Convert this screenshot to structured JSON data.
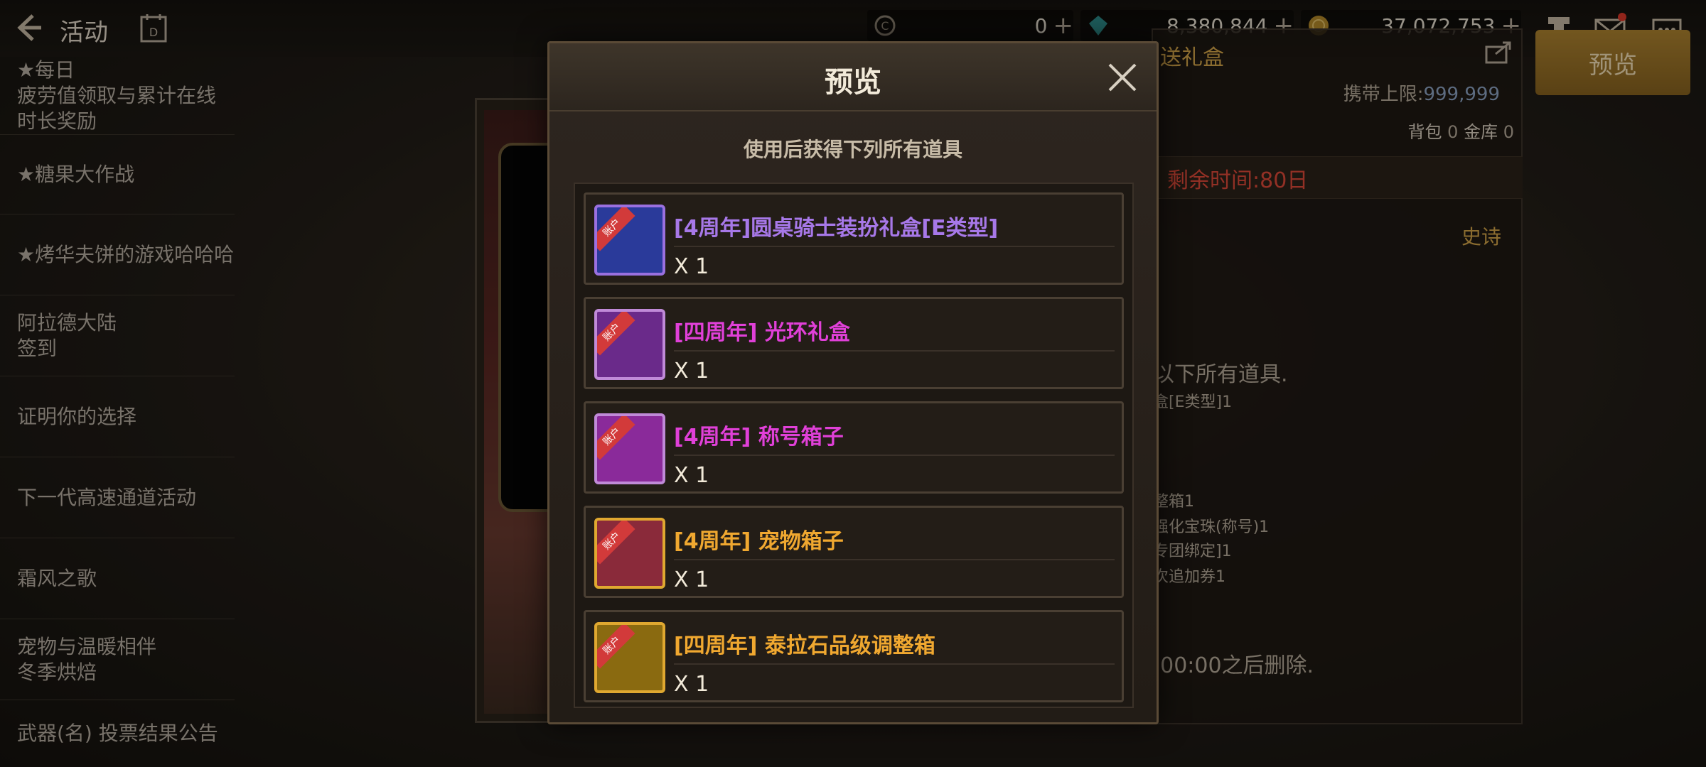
{
  "topbar": {
    "title": "活动",
    "calendar_label": "D",
    "currencies": [
      {
        "icon": "coin-c-icon",
        "amount": "0"
      },
      {
        "icon": "crystal-icon",
        "amount": "8,380,844"
      },
      {
        "icon": "gold-coin-icon",
        "amount": "37,072,753"
      }
    ]
  },
  "menu": {
    "items": [
      {
        "label": "★每日\n疲劳值领取与累计在线时长奖励"
      },
      {
        "label": "★糖果大作战"
      },
      {
        "label": "★烤华夫饼的游戏哈哈哈"
      },
      {
        "label": "阿拉德大陆\n签到"
      },
      {
        "label": "证明你的选择"
      },
      {
        "label": "下一代高速通道活动"
      },
      {
        "label": "霜风之歌"
      },
      {
        "label": "宠物与温暖相伴\n冬季烘焙"
      },
      {
        "label": "武器(名) 投票结果公告"
      }
    ]
  },
  "detail": {
    "title_fragment": "送礼盒",
    "limit_label": "携带上限:",
    "limit_value": "999,999",
    "bag_label": "背包",
    "bag_value": "0",
    "vault_label": "金库",
    "vault_value": "0",
    "time_left": "剩余时间:80日",
    "rarity": "史诗",
    "desc_lines": [
      "以下所有道具.",
      "盒[E类型]1",
      "",
      "整箱1",
      "强化宝珠(称号)1",
      "专团绑定]1",
      "次追加券1"
    ],
    "delete_note": ":00:00之后删除."
  },
  "preview_button": "预览",
  "modal": {
    "title": "预览",
    "subtitle": "使用后获得下列所有道具",
    "items": [
      {
        "name": "[4周年]圆桌骑士装扮礼盒[E类型]",
        "qty": "X 1",
        "color": "#a778e8",
        "border": "#9a70e0",
        "tag": "账户",
        "art": "#2a3a9a"
      },
      {
        "name": "[四周年] 光环礼盒",
        "qty": "X 1",
        "color": "#e040d8",
        "border": "#c08ad8",
        "tag": "账户",
        "art": "#6a2a8a"
      },
      {
        "name": "[4周年] 称号箱子",
        "qty": "X 1",
        "color": "#e040d8",
        "border": "#c08ad8",
        "tag": "账户",
        "art": "#8a2a9a"
      },
      {
        "name": "[4周年] 宠物箱子",
        "qty": "X 1",
        "color": "#f0a830",
        "border": "#e0a830",
        "tag": "账户",
        "art": "#8a2a3a"
      },
      {
        "name": "[四周年] 泰拉石品级调整箱",
        "qty": "X 1",
        "color": "#f0a830",
        "border": "#e0a830",
        "tag": "账户",
        "art": "#8a6a10"
      }
    ]
  }
}
